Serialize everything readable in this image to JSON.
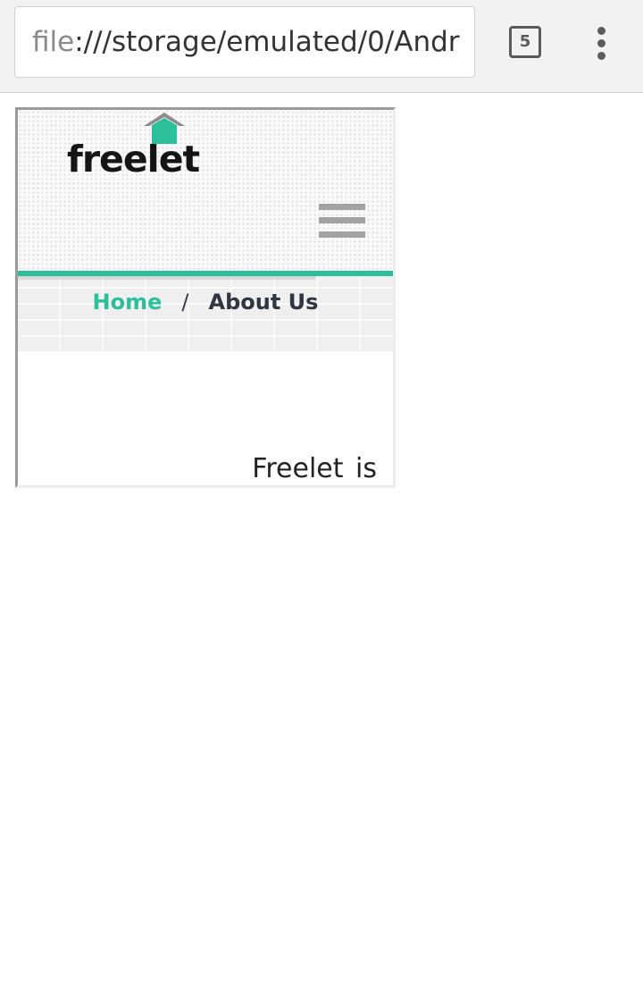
{
  "browser": {
    "url_scheme": "file",
    "url_rest": ":///storage/emulated/0/Andr",
    "tab_count": "5",
    "icons": {
      "tabs": "tab-switcher-icon",
      "menu": "overflow-menu-icon"
    }
  },
  "site": {
    "logo_text": "freelet",
    "logo_icon": "house-icon",
    "menu_icon": "hamburger-menu-icon",
    "breadcrumb": {
      "home": "Home",
      "separator": "/",
      "current": "About Us"
    },
    "content_text": "Freelet is"
  },
  "colors": {
    "accent": "#2bbf9c",
    "roof": "#8c8c8c",
    "logo_text": "#151515",
    "breadcrumb_current": "#2e3641",
    "hamburger": "#a3a3a3",
    "toolbar_bg": "#f2f2f2"
  }
}
